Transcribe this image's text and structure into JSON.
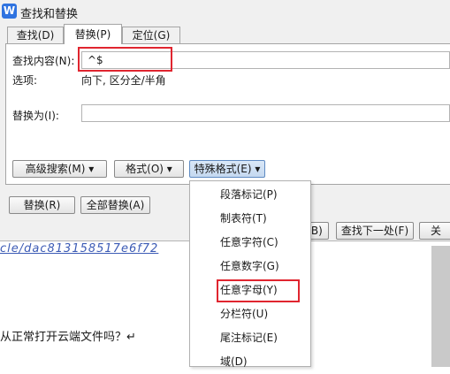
{
  "window": {
    "title": "查找和替换",
    "app_icon": "W"
  },
  "tabs": [
    {
      "label": "查找(D)"
    },
    {
      "label": "替换(P)"
    },
    {
      "label": "定位(G)"
    }
  ],
  "find": {
    "label": "查找内容(N):",
    "value": "^$"
  },
  "options": {
    "label": "选项:",
    "value": "向下, 区分全/半角"
  },
  "replace": {
    "label": "替换为(I):",
    "value": ""
  },
  "buttons": {
    "advanced_search": "高级搜索(M) ▾",
    "format": "格式(O) ▾",
    "special_format": "特殊格式(E) ▾",
    "replace": "替换(R)",
    "replace_all": "全部替换(A)",
    "find_prev_partial": "(B)",
    "find_next": "查找下一处(F)",
    "close_partial": "关"
  },
  "special_menu": {
    "items": [
      {
        "label": "段落标记(P)"
      },
      {
        "label": "制表符(T)"
      },
      {
        "label": "任意字符(C)"
      },
      {
        "label": "任意数字(G)"
      },
      {
        "label": "任意字母(Y)"
      },
      {
        "label": "分栏符(U)"
      },
      {
        "label": "尾注标记(E)"
      },
      {
        "label": "域(D)"
      }
    ],
    "highlighted": "任意字母(Y)"
  },
  "document": {
    "link_fragment": "cle/dac813158517e6f72",
    "question_text": "从正常打开云端文件吗？↵"
  },
  "colors": {
    "highlight_red": "#e0252f",
    "link_blue": "#3c5bb5",
    "app_blue": "#2f73e0"
  }
}
